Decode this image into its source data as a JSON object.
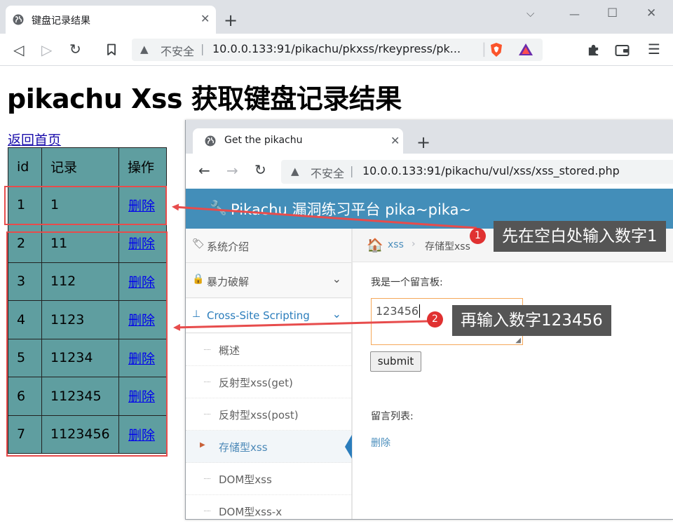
{
  "browser": {
    "tab_title": "键盘记录结果",
    "insecure_label": "不安全",
    "url": "10.0.0.133:91/pikachu/pkxss/rkeypress/pk..."
  },
  "page": {
    "heading": "pikachu Xss 获取键盘记录结果",
    "back_link": "返回首页",
    "table": {
      "headers": [
        "id",
        "记录",
        "操作"
      ],
      "rows": [
        {
          "id": "1",
          "record": "1",
          "action": "删除"
        },
        {
          "id": "2",
          "record": "11",
          "action": "删除"
        },
        {
          "id": "3",
          "record": "112",
          "action": "删除"
        },
        {
          "id": "4",
          "record": "1123",
          "action": "删除"
        },
        {
          "id": "5",
          "record": "11234",
          "action": "删除"
        },
        {
          "id": "6",
          "record": "112345",
          "action": "删除"
        },
        {
          "id": "7",
          "record": "1123456",
          "action": "删除"
        }
      ]
    }
  },
  "popup_window": {
    "tab_title": "Get the pikachu",
    "insecure_label": "不安全",
    "url": "10.0.0.133:91/pikachu/vul/xss/xss_stored.php",
    "header_title": "Pikachu 漏洞练习平台 pika~pika~",
    "breadcrumb": {
      "parent": "xss",
      "current": "存储型xss"
    },
    "sidebar": {
      "items": [
        {
          "label": "系统介绍"
        },
        {
          "label": "暴力破解"
        },
        {
          "label": "Cross-Site Scripting"
        }
      ],
      "sub_items": [
        "概述",
        "反射型xss(get)",
        "反射型xss(post)",
        "存储型xss",
        "DOM型xss",
        "DOM型xss-x"
      ]
    },
    "board_label": "我是一个留言板:",
    "textarea_value": "123456",
    "submit_label": "submit",
    "list_label": "留言列表:",
    "delete_link": "删除"
  },
  "annotations": {
    "step1_number": "1",
    "step1_text": "先在空白处输入数字1",
    "step2_number": "2",
    "step2_text": "再输入数字123456",
    "accent_color": "#e74c4c"
  }
}
